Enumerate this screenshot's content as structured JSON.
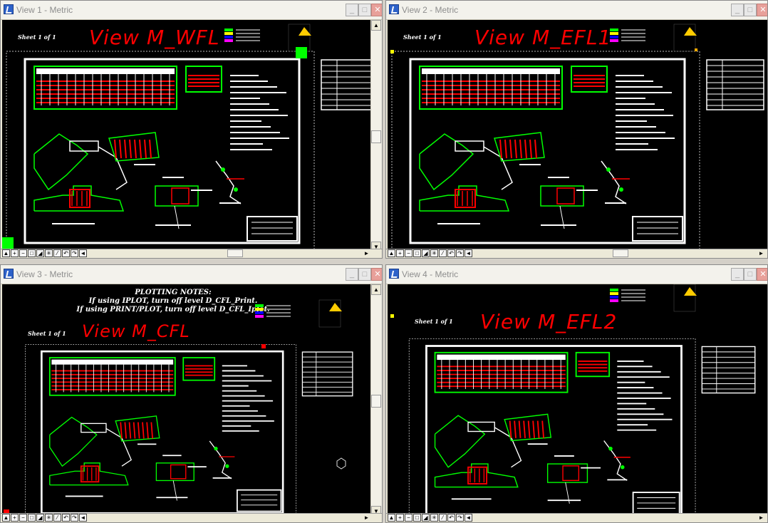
{
  "windows": [
    {
      "title": "View 1 - Metric",
      "sheet_label": "Sheet 1 of 1",
      "view_title": "View M_WFL"
    },
    {
      "title": "View 2 - Metric",
      "sheet_label": "Sheet 1 of 1",
      "view_title": "View M_EFL1"
    },
    {
      "title": "View 3 - Metric",
      "sheet_label": "Sheet 1 of 1",
      "view_title": "View M_CFL",
      "notes": [
        "PLOTTING NOTES:",
        "If using IPLOT, turn off level D_CFL_Print.",
        "If using PRINT/PLOT, turn off level D_CFL_Iplot."
      ]
    },
    {
      "title": "View 4 - Metric",
      "sheet_label": "Sheet 1 of 1",
      "view_title": "View M_EFL2"
    }
  ],
  "controls": {
    "minimize": "_",
    "maximize": "□",
    "close": "✕",
    "scroll_up": "▲",
    "scroll_down": "▼",
    "scroll_left": "◄",
    "scroll_right": "►"
  },
  "icons": {
    "title_icon": "microstation-view-icon",
    "view_tools": [
      "view-attributes-icon",
      "zoom-in-icon",
      "zoom-out-icon",
      "window-area-icon",
      "fit-view-icon",
      "rotate-view-icon",
      "pan-view-icon",
      "view-previous-icon",
      "view-next-icon",
      "copy-view-icon"
    ]
  },
  "colors": {
    "canvas": "#000000",
    "view_title": "#ff0000",
    "drawing_white": "#ffffff",
    "drawing_green": "#00ff00",
    "drawing_red": "#ff0000",
    "titlebar_bg": "#f3f2ec"
  }
}
